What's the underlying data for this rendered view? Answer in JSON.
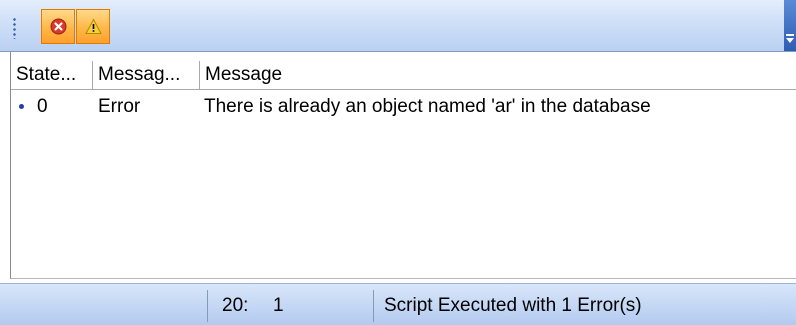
{
  "toolbar": {
    "buttons": [
      {
        "name": "errors",
        "icon": "error-icon"
      },
      {
        "name": "warnings",
        "icon": "warning-icon"
      }
    ]
  },
  "grid": {
    "columns": [
      "State...",
      "Messag...",
      "Message"
    ],
    "rows": [
      {
        "state": "0",
        "type": "Error",
        "message": "There is already an object named 'ar' in the database"
      }
    ]
  },
  "statusbar": {
    "line": "20:",
    "column": "1",
    "message": "Script Executed with 1 Error(s)"
  },
  "colors": {
    "toolbar_bg": "#cfdff8",
    "button_active": "#ffb848",
    "error_red": "#d9382a",
    "warning_yellow": "#f4d03f",
    "bullet_blue": "#1f3fa6"
  }
}
